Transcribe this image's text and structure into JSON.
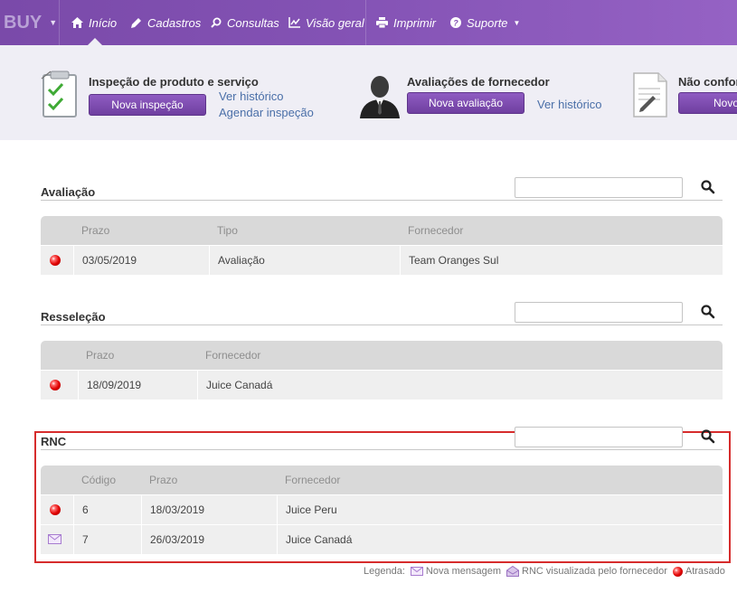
{
  "nav": {
    "brand": "BUY",
    "items": [
      {
        "label": "Início",
        "icon": "home-icon"
      },
      {
        "label": "Cadastros",
        "icon": "pencil-icon"
      },
      {
        "label": "Consultas",
        "icon": "search-icon"
      },
      {
        "label": "Visão geral",
        "icon": "chart-icon"
      },
      {
        "label": "Imprimir",
        "icon": "printer-icon"
      },
      {
        "label": "Suporte",
        "icon": "help-icon"
      }
    ]
  },
  "quick": {
    "inspecao": {
      "title": "Inspeção de produto e serviço",
      "button": "Nova inspeção",
      "link1": "Ver histórico",
      "link2": "Agendar inspeção",
      "icon": "clipboard-check-icon"
    },
    "avaliacoes": {
      "title": "Avaliações de fornecedor",
      "button": "Nova avaliação",
      "link1": "Ver histórico",
      "icon": "person-icon"
    },
    "nc": {
      "title": "Não confor",
      "button": "Novo",
      "icon": "document-edit-icon"
    }
  },
  "sections": {
    "avaliacao": {
      "title": "Avaliação",
      "search_value": "",
      "columns": [
        "Prazo",
        "Tipo",
        "Fornecedor"
      ],
      "rows": [
        {
          "status": "atrasado",
          "prazo": "03/05/2019",
          "tipo": "Avaliação",
          "fornecedor": "Team Oranges Sul"
        }
      ]
    },
    "resselecao": {
      "title": "Resseleção",
      "search_value": "",
      "columns": [
        "Prazo",
        "Fornecedor"
      ],
      "rows": [
        {
          "status": "atrasado",
          "prazo": "18/09/2019",
          "fornecedor": "Juice Canadá"
        }
      ]
    },
    "rnc": {
      "title": "RNC",
      "search_value": "",
      "columns": [
        "Código",
        "Prazo",
        "Fornecedor"
      ],
      "rows": [
        {
          "status": "atrasado",
          "codigo": "6",
          "prazo": "18/03/2019",
          "fornecedor": "Juice Peru"
        },
        {
          "status": "nova-mensagem",
          "codigo": "7",
          "prazo": "26/03/2019",
          "fornecedor": "Juice Canadá"
        }
      ]
    }
  },
  "legend": {
    "label": "Legenda:",
    "nova_mensagem": "Nova mensagem",
    "rnc_visualizada": "RNC visualizada pelo fornecedor",
    "atrasado": "Atrasado"
  },
  "colors": {
    "nav_purple": "#8352b4",
    "button_purple": "#7b48ad",
    "link_blue": "#4a6fa8",
    "late_red": "#e00000",
    "highlight_border": "#d62c2c"
  }
}
